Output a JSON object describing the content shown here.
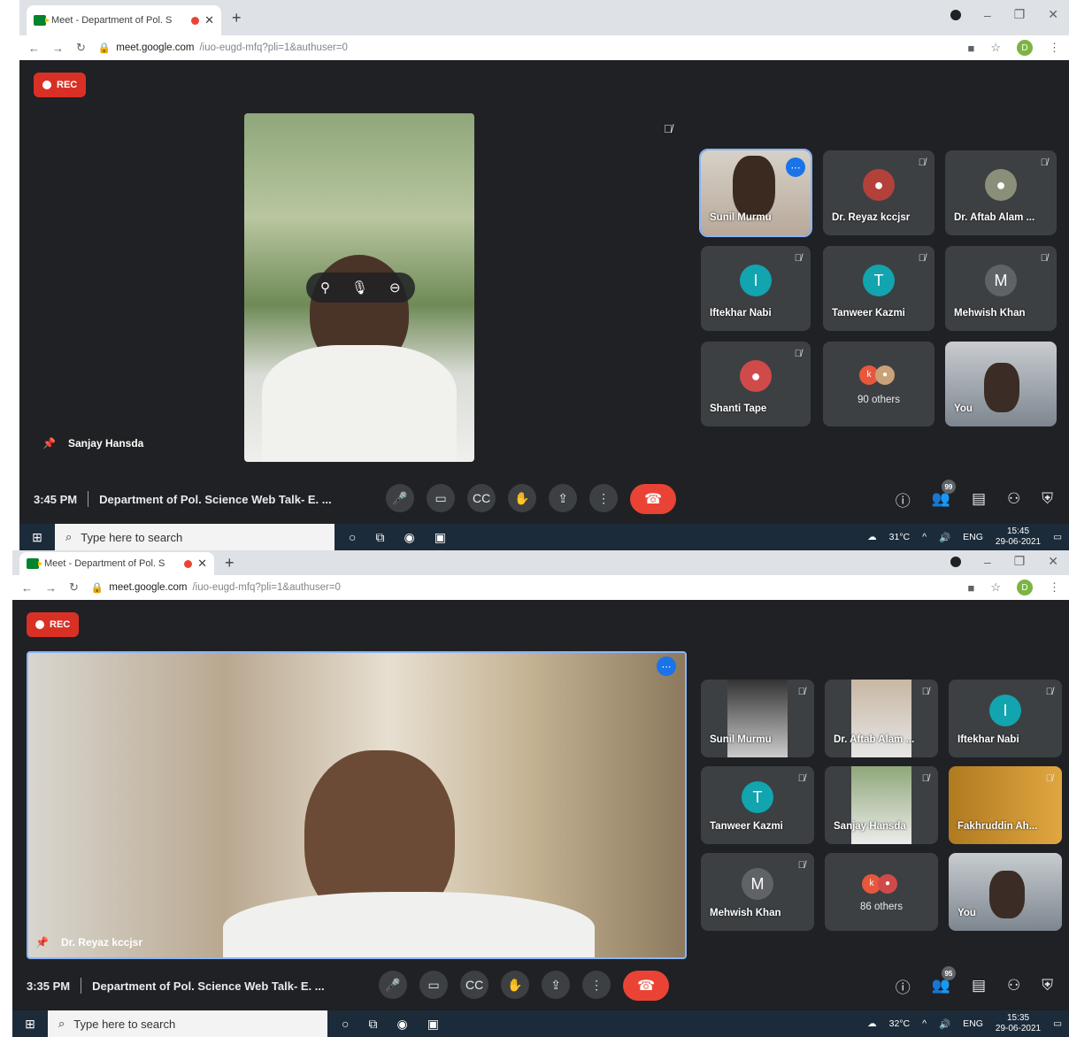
{
  "shot1": {
    "tab_title": "Meet - Department of Pol. S",
    "url_host": "meet.google.com",
    "url_rest": "/iuo-eugd-mfq?pli=1&authuser=0",
    "profile_initial": "D",
    "rec_label": "REC",
    "main_speaker": "Sanjay Hansda",
    "tiles": [
      {
        "name": "Sunil Murmu",
        "kind": "video"
      },
      {
        "name": "Dr. Reyaz kccjsr",
        "kind": "photo"
      },
      {
        "name": "Dr. Aftab Alam ...",
        "kind": "photo"
      },
      {
        "name": "Iftekhar Nabi",
        "kind": "avatar",
        "initial": "I",
        "color": "#12a4af"
      },
      {
        "name": "Tanweer Kazmi",
        "kind": "avatar",
        "initial": "T",
        "color": "#12a4af"
      },
      {
        "name": "Mehwish Khan",
        "kind": "avatar",
        "initial": "M",
        "color": "#5f6368"
      },
      {
        "name": "Shanti Tape",
        "kind": "photo"
      },
      {
        "name": "90 others",
        "kind": "others"
      },
      {
        "name": "You",
        "kind": "video"
      }
    ],
    "time": "3:45 PM",
    "meeting_title": "Department of Pol. Science Web Talk- E. ...",
    "people_count": "99",
    "taskbar_search": "Type here to search",
    "temperature": "31°C",
    "lang": "ENG",
    "clock_time": "15:45",
    "clock_date": "29-06-2021"
  },
  "shot2": {
    "tab_title": "Meet - Department of Pol. S",
    "url_host": "meet.google.com",
    "url_rest": "/iuo-eugd-mfq?pli=1&authuser=0",
    "profile_initial": "D",
    "rec_label": "REC",
    "main_speaker": "Dr. Reyaz kccjsr",
    "tiles": [
      {
        "name": "Sunil Murmu",
        "kind": "video"
      },
      {
        "name": "Dr. Aftab Alam ...",
        "kind": "photo"
      },
      {
        "name": "Iftekhar Nabi",
        "kind": "avatar",
        "initial": "I",
        "color": "#12a4af"
      },
      {
        "name": "Tanweer Kazmi",
        "kind": "avatar",
        "initial": "T",
        "color": "#12a4af"
      },
      {
        "name": "Sanjay Hansda",
        "kind": "photo"
      },
      {
        "name": "Fakhruddin Ah...",
        "kind": "video"
      },
      {
        "name": "Mehwish Khan",
        "kind": "avatar",
        "initial": "M",
        "color": "#5f6368"
      },
      {
        "name": "86 others",
        "kind": "others"
      },
      {
        "name": "You",
        "kind": "video"
      }
    ],
    "time": "3:35 PM",
    "meeting_title": "Department of Pol. Science Web Talk- E. ...",
    "people_count": "95",
    "taskbar_search": "Type here to search",
    "temperature": "32°C",
    "lang": "ENG",
    "clock_time": "15:35",
    "clock_date": "29-06-2021"
  },
  "icons": {
    "mic": "microphone-icon",
    "camera": "camera-icon",
    "captions": "captions-icon",
    "hand": "raise-hand-icon",
    "present": "present-icon",
    "more": "more-vert-icon",
    "end": "end-call-icon"
  },
  "colors": {
    "meet_bg": "#202124",
    "tile_bg": "#3c4043",
    "rec_red": "#d93025",
    "end_red": "#ea4335",
    "accent_blue": "#1a73e8"
  }
}
